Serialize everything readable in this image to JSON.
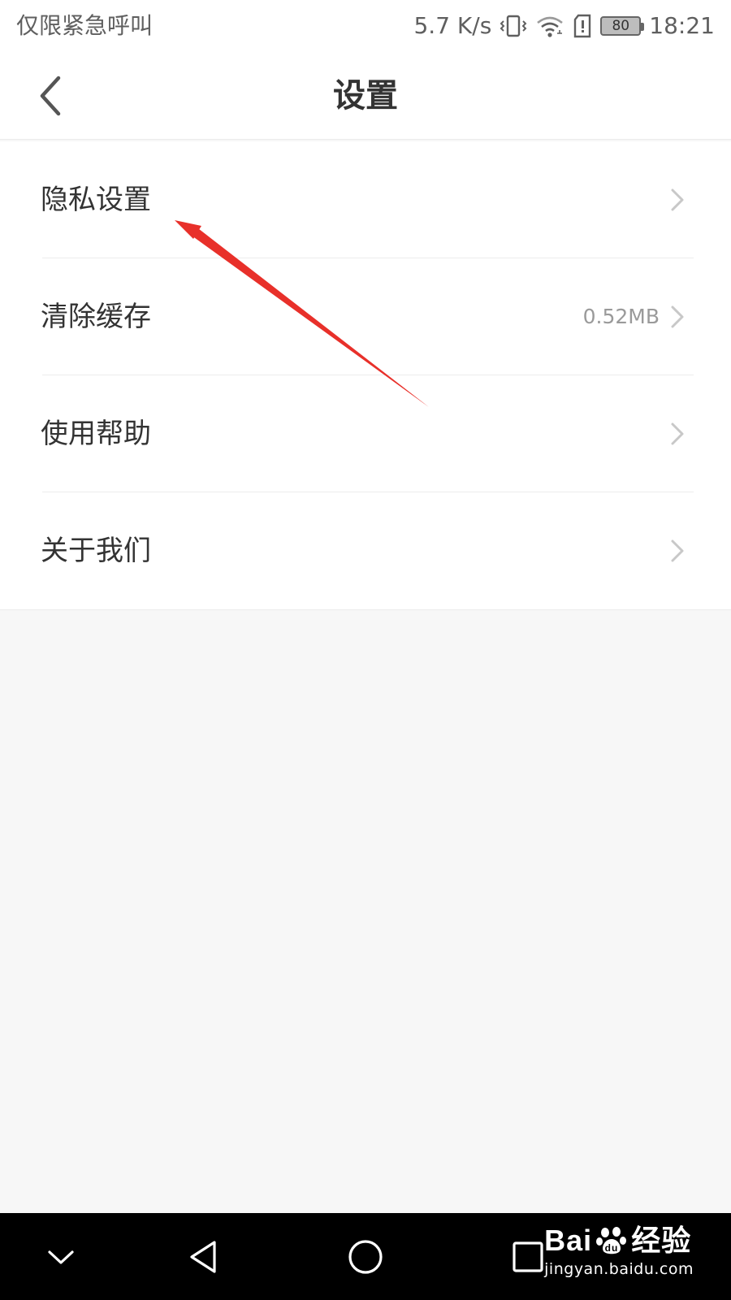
{
  "status_bar": {
    "carrier": "仅限紧急呼叫",
    "speed": "5.7 K/s",
    "battery": "80",
    "time": "18:21",
    "icons": [
      "vibrate-icon",
      "wifi-icon",
      "sim-alert-icon",
      "battery-icon"
    ]
  },
  "header": {
    "title": "设置",
    "back_icon": "back-chevron-icon"
  },
  "settings": {
    "items": [
      {
        "label": "隐私设置",
        "value": ""
      },
      {
        "label": "清除缓存",
        "value": "0.52MB"
      },
      {
        "label": "使用帮助",
        "value": ""
      },
      {
        "label": "关于我们",
        "value": ""
      }
    ]
  },
  "annotation": {
    "type": "arrow",
    "color": "#e8302a"
  },
  "nav_bar": {
    "buttons": [
      "collapse-icon",
      "back-triangle-icon",
      "home-circle-icon",
      "recents-square-icon"
    ]
  },
  "watermark": {
    "logo_text": "Bai",
    "logo_suffix": "经验",
    "url": "jingyan.baidu.com"
  },
  "colors": {
    "background": "#f7f7f7",
    "surface": "#ffffff",
    "text_primary": "#333333",
    "text_secondary": "#9a9a9a",
    "divider": "#ececec",
    "nav_bar": "#000000"
  }
}
